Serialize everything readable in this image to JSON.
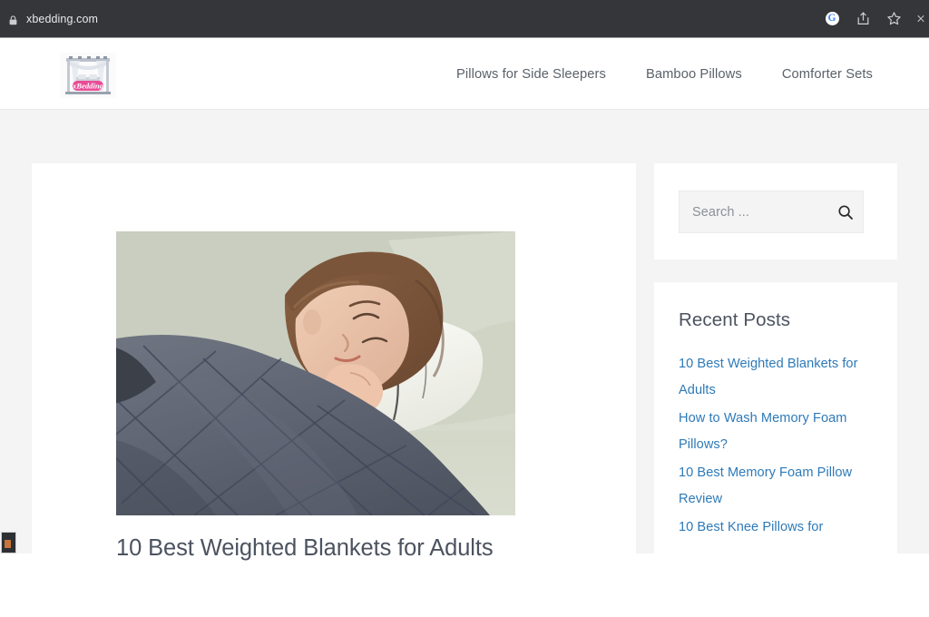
{
  "browser": {
    "url": "xbedding.com",
    "lock_icon": "lock-icon",
    "actions": [
      {
        "name": "google-account-icon",
        "label": "G"
      },
      {
        "name": "share-icon",
        "label": ""
      },
      {
        "name": "bookmark-star-icon",
        "label": ""
      },
      {
        "name": "browser-menu-icon",
        "label": ""
      }
    ]
  },
  "site": {
    "logo_alt": "xBedding",
    "logo_text": "xBedding",
    "nav": [
      {
        "label": "Pillows for Side Sleepers"
      },
      {
        "label": "Bamboo Pillows"
      },
      {
        "label": "Comforter Sets"
      }
    ]
  },
  "article": {
    "title": "10 Best Weighted Blankets for Adults",
    "image_alt": "Woman sleeping under a grey weighted blanket on a sofa"
  },
  "sidebar": {
    "search": {
      "placeholder": "Search ...",
      "value": "",
      "icon": "search-icon"
    },
    "recent_posts": {
      "title": "Recent Posts",
      "items": [
        {
          "label": "10 Best Weighted Blankets for Adults"
        },
        {
          "label": "How to Wash Memory Foam Pillows?"
        },
        {
          "label": "10 Best Memory Foam Pillow Review"
        },
        {
          "label": "10 Best Knee Pillows for"
        }
      ]
    }
  },
  "colors": {
    "chrome_bg": "#35363a",
    "page_bg": "#f4f4f4",
    "card_bg": "#ffffff",
    "link": "#2e7ab8",
    "heading": "#4c5360",
    "nav_text": "#5a6169",
    "logo_pink": "#e8408f"
  }
}
